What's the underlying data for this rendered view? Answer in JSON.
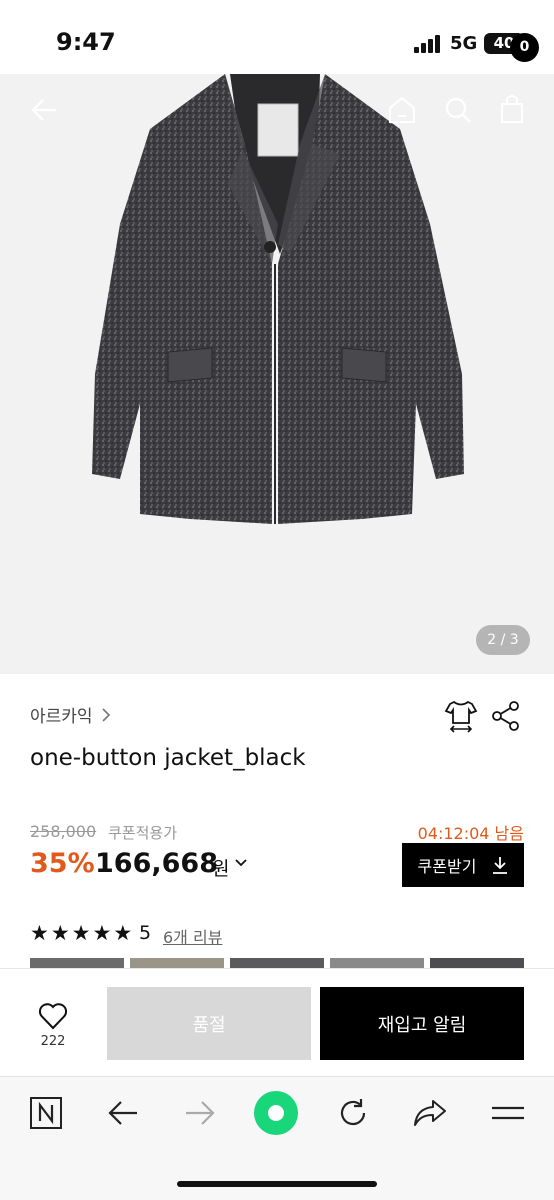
{
  "status_bar": {
    "time": "9:47",
    "network": "5G",
    "battery": "40"
  },
  "nav": {
    "back_icon": "back-arrow-icon",
    "home_icon": "home-icon",
    "search_icon": "search-icon",
    "cart_icon": "shopping-bag-icon",
    "cart_count": "0"
  },
  "gallery": {
    "page_indicator": "2 / 3"
  },
  "product": {
    "brand": "아르카익",
    "title": "one-button jacket_black",
    "original_price": "258,000",
    "coupon_note": "쿠폰적용가",
    "timer": "04:12:04 남음",
    "discount": "35%",
    "price": "166,668",
    "currency": "원",
    "coupon_button": "쿠폰받기",
    "rating_stars": 5,
    "rating_value": "5",
    "review_link": "6개 리뷰"
  },
  "purchase_bar": {
    "wish_count": "222",
    "soldout_label": "품절",
    "restock_label": "재입고 알림"
  },
  "browser_toolbar": {
    "icons": [
      "naver-n-icon",
      "back-icon",
      "forward-icon",
      "green-dot-icon",
      "refresh-icon",
      "share-icon",
      "menu-icon"
    ]
  },
  "colors": {
    "accent": "#e05a1c",
    "primary_button": "#000000",
    "disabled_button": "#d8d8d8",
    "green_button": "#19d67a"
  }
}
